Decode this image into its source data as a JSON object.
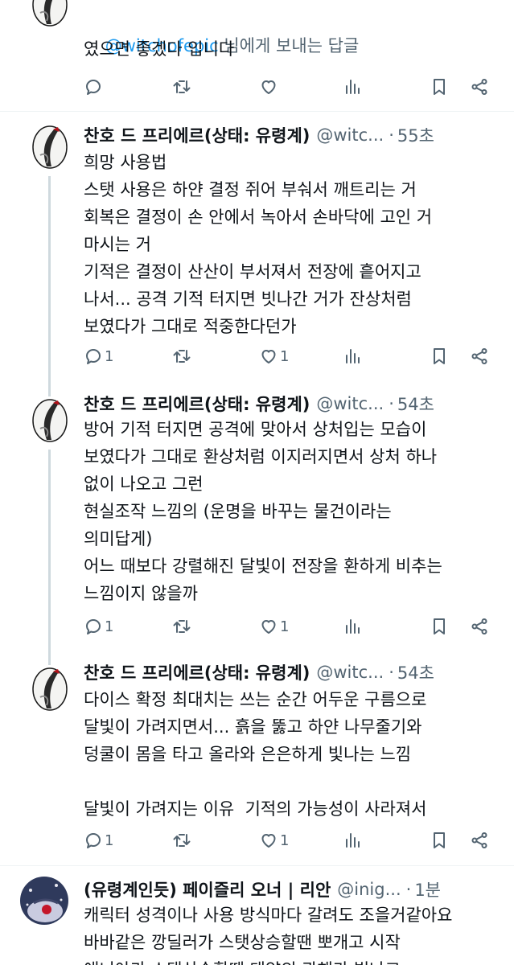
{
  "tweets": [
    {
      "reply_mention": "@witchofepic",
      "reply_suffix": " 님에게 보내는 답글",
      "text": "였으면 좋겠다 입니다",
      "counts": {
        "reply": "",
        "like": ""
      }
    },
    {
      "name": "찬호 드 프리에르(상태: 유령계)",
      "handle": "@witc...",
      "time": "55초",
      "text": "희망 사용법\n스탯 사용은 하얀 결정 쥐어 부숴서 깨트리는 거\n회복은 결정이 손 안에서 녹아서 손바닥에 고인 거\n마시는 거\n기적은 결정이 산산이 부서져서 전장에 흩어지고\n나서... 공격 기적 터지면 빗나간 거가 잔상처럼\n보였다가 그대로 적중한다던가",
      "counts": {
        "reply": "1",
        "like": "1"
      }
    },
    {
      "name": "찬호 드 프리에르(상태: 유령계)",
      "handle": "@witc...",
      "time": "54초",
      "text": "방어 기적 터지면 공격에 맞아서 상처입는 모습이\n보였다가 그대로 환상처럼 이지러지면서 상처 하나\n없이 나오고 그런\n현실조작 느낌의 (운명을 바꾸는 물건이라는\n의미답게)\n어느 때보다 강렬해진 달빛이 전장을 환하게 비추는\n느낌이지 않을까",
      "counts": {
        "reply": "1",
        "like": "1"
      }
    },
    {
      "name": "찬호 드 프리에르(상태: 유령계)",
      "handle": "@witc...",
      "time": "54초",
      "text": "다이스 확정 최대치는 쓰는 순간 어두운 구름으로\n달빛이 가려지면서... 흙을 뚫고 하얀 나무줄기와\n덩쿨이 몸을 타고 올라와 은은하게 빛나는 느낌\n\n달빛이 가려지는 이유  기적의 가능성이 사라져서",
      "counts": {
        "reply": "1",
        "like": "1"
      }
    },
    {
      "name": "(유령계인듯) 페이즐리 오너 | 리안",
      "handle": "@inig...",
      "time": "1분",
      "text": "캐릭터 성격이나 사용 방식마다 갈려도 조을거같아요\n바바같은 깡딜러가 스탯상승할땐 뽀개고 시작\n얘니야가 스탯상승할땐 태양의 관해가 빛나고"
    }
  ],
  "icons": [
    "reply-icon",
    "retweet-icon",
    "like-icon",
    "views-icon",
    "bookmark-icon",
    "share-icon"
  ],
  "colors": {
    "text": "#0f1419",
    "secondary": "#536471",
    "mention": "#1d9bf0",
    "thread_line": "#cfd9de",
    "separator": "#eff3f4"
  }
}
